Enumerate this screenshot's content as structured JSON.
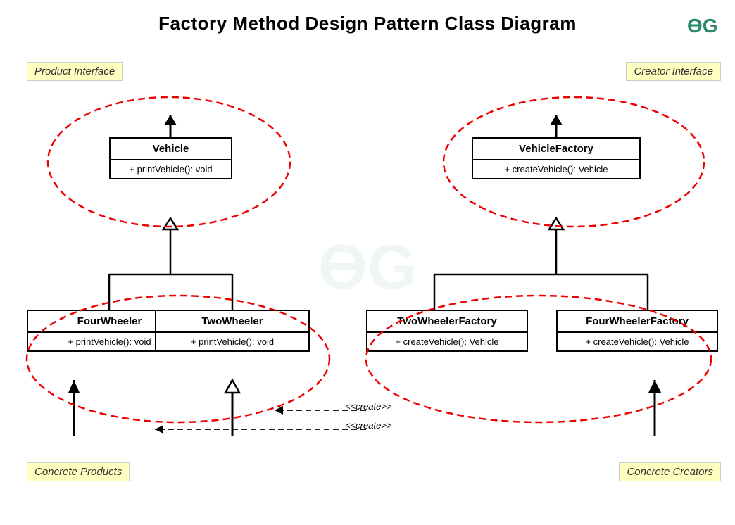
{
  "title": "Factory Method Design Pattern Class Diagram",
  "labels": {
    "product_interface": "Product Interface",
    "creator_interface": "Creator Interface",
    "concrete_products": "Concrete Products",
    "concrete_creators": "Concrete Creators"
  },
  "classes": {
    "vehicle": {
      "name": "Vehicle",
      "method": "+ printVehicle(): void"
    },
    "vehicle_factory": {
      "name": "VehicleFactory",
      "method": "+ createVehicle(): Vehicle"
    },
    "four_wheeler": {
      "name": "FourWheeler",
      "method": "+ printVehicle(): void"
    },
    "two_wheeler": {
      "name": "TwoWheeler",
      "method": "+ printVehicle(): void"
    },
    "two_wheeler_factory": {
      "name": "TwoWheelerFactory",
      "method": "+ createVehicle(): Vehicle"
    },
    "four_wheeler_factory": {
      "name": "FourWheelerFactory",
      "method": "+ createVehicle(): Vehicle"
    }
  },
  "relationships": {
    "create1": "<<create>>",
    "create2": "<<create>>"
  },
  "logo": {
    "color": "#2d8a6e",
    "text": "ϴG"
  }
}
